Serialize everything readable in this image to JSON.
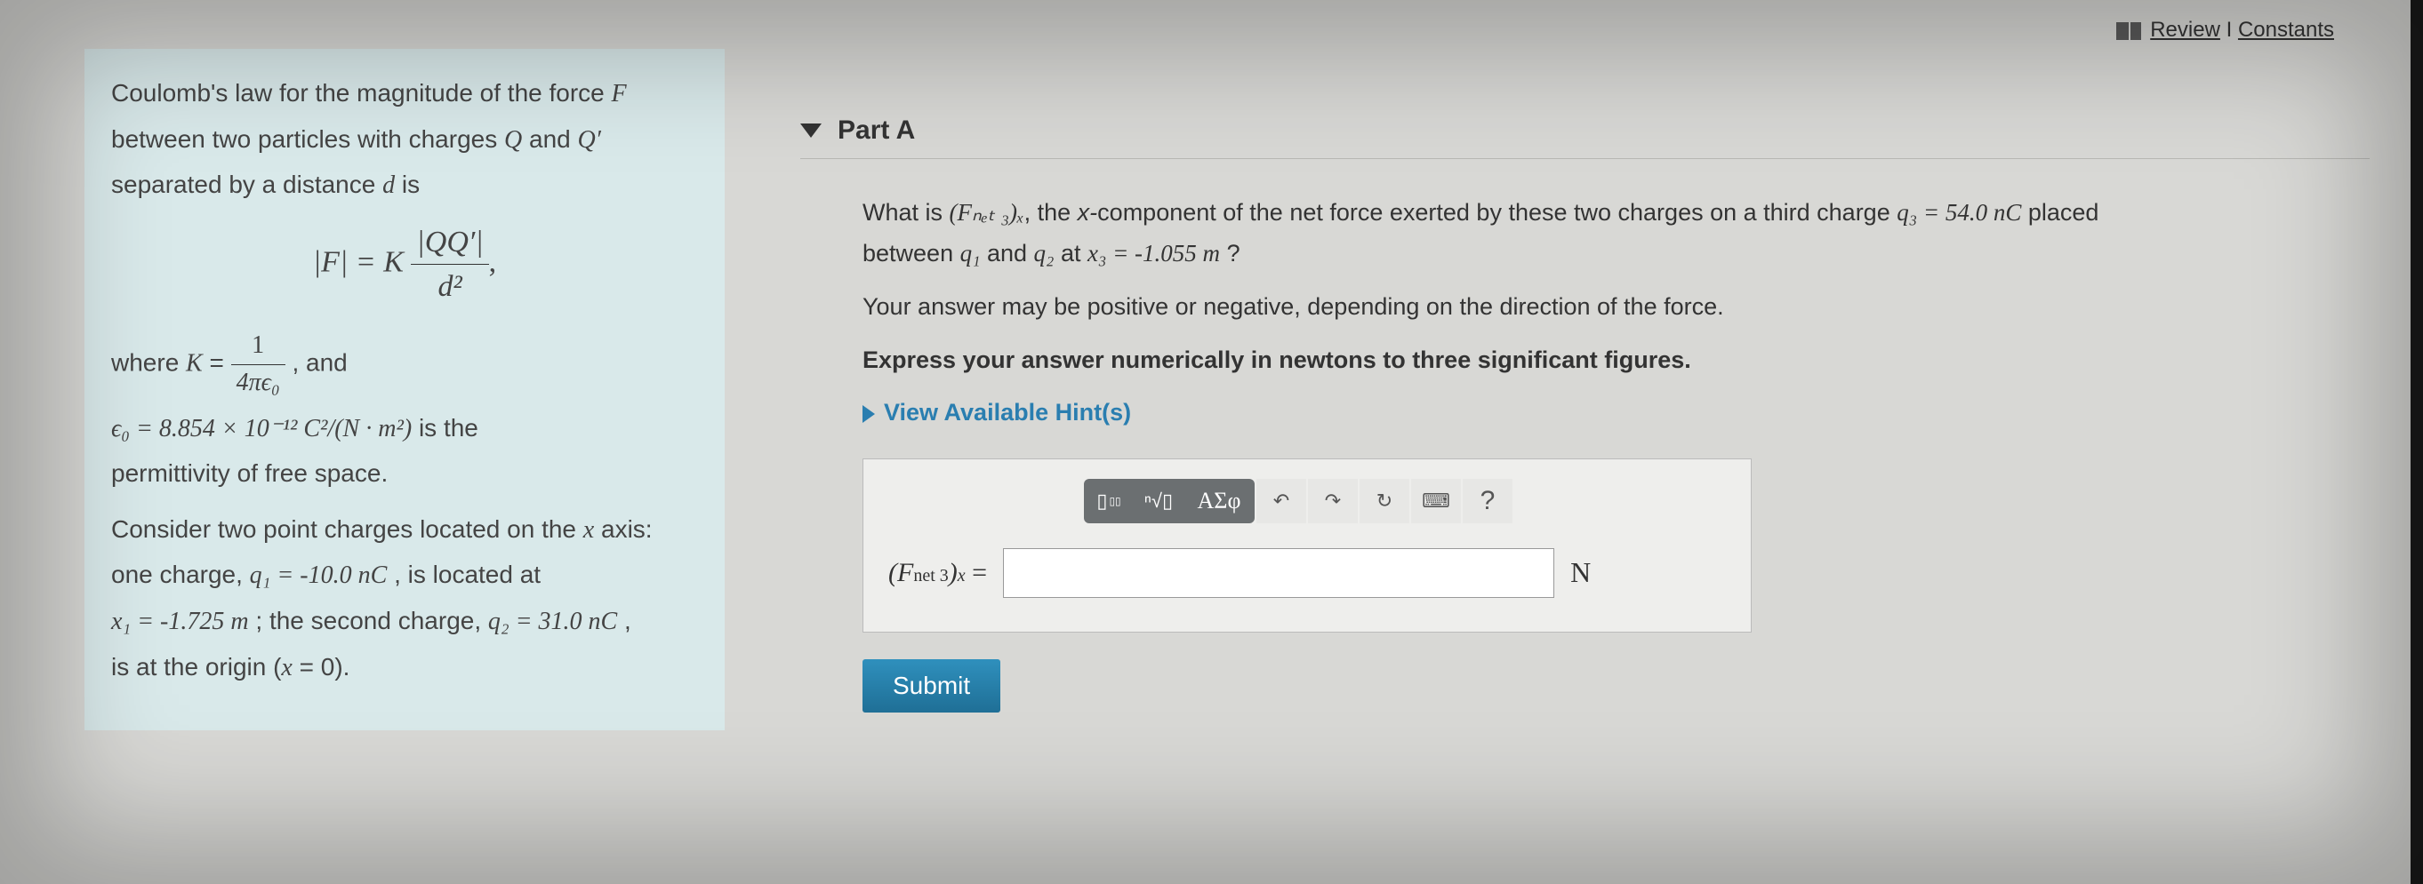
{
  "topLinks": {
    "review": "Review",
    "sep": " I ",
    "constants": "Constants"
  },
  "left": {
    "intro1a": "Coulomb's law for the magnitude of the force ",
    "intro1_F": "F",
    "intro2a": "between two particles with charges ",
    "intro2_Q": "Q",
    "intro2_and": " and ",
    "intro2_Qp": "Q′",
    "intro3a": "separated by a distance ",
    "intro3_d": "d",
    "intro3b": " is",
    "formula_lhs": "|F| = K",
    "formula_num": "|QQ′|",
    "formula_den": "d²",
    "formula_tail": ",",
    "where_a": "where ",
    "where_K": "K",
    "where_eq": " = ",
    "where_num": "1",
    "where_den": "4πϵ₀",
    "where_tail": " , and",
    "eps_a": "ϵ₀ = 8.854 × 10⁻¹² C²/(N · m²)",
    "eps_b": " is the",
    "perm": "permittivity of free space.",
    "p2a": "Consider two point charges located on the ",
    "p2x": "x",
    "p2b": " axis:",
    "p3a": "one charge, ",
    "p3q1": "q₁ = -10.0 nC",
    "p3b": " , is located at",
    "p4a": "x₁ = -1.725 m",
    "p4b": " ; the second charge, ",
    "p4q2": "q₂ = 31.0 nC",
    "p4c": " ,",
    "p5a": "is at the origin (",
    "p5x": "x",
    "p5b": " = 0)."
  },
  "part": {
    "title": "Part A"
  },
  "q": {
    "line1a": "What is ",
    "line1F": "(Fₙₑₜ ₃)ₓ",
    "line1b": ", the ",
    "line1xc": "x-",
    "line1c": "component of the net force exerted by these two charges on a third charge ",
    "line1q3": "q₃ = 54.0 nC",
    "line1d": " placed",
    "line2a": "between ",
    "line2q1": "q₁",
    "line2b": " and ",
    "line2q2": "q₂",
    "line2c": " at ",
    "line2x3": "x₃ = -1.055 m",
    "line2d": " ?",
    "note": "Your answer may be positive or negative, depending on the direction of the force.",
    "express": "Express your answer numerically in newtons to three significant figures.",
    "hints": "View Available Hint(s)"
  },
  "toolbar": {
    "template": "▯",
    "radical": "ⁿ√▯",
    "greek": "ΑΣφ",
    "undo": "↶",
    "redo": "↷",
    "reset": "↻",
    "keyboard": "⌨",
    "help": "?"
  },
  "answer": {
    "lhs_open": "(",
    "lhs_F": "F",
    "lhs_sub": "net 3",
    "lhs_close": ")",
    "lhs_x": "x",
    "lhs_eq": " = ",
    "unit": "N"
  },
  "submit": "Submit"
}
